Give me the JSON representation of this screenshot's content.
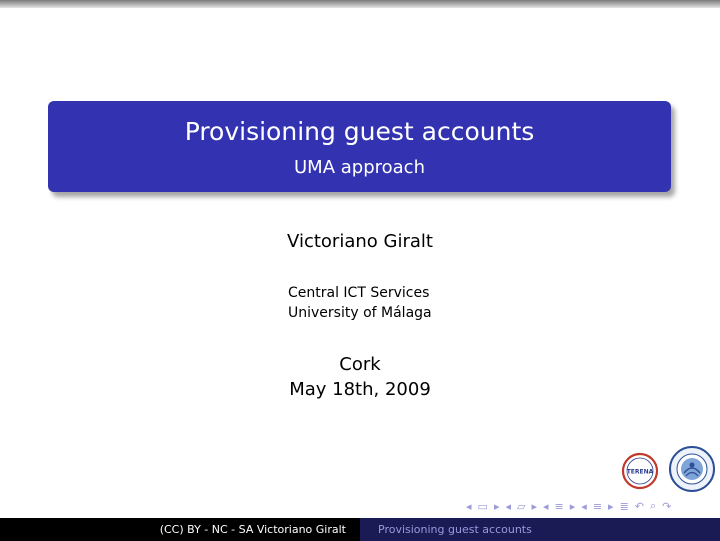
{
  "slide": {
    "title": "Provisioning guest accounts",
    "subtitle": "UMA approach",
    "author": "Victoriano Giralt",
    "institute_line1": "Central ICT Services",
    "institute_line2": "University of Málaga",
    "place": "Cork",
    "date": "May 18th, 2009"
  },
  "logos": {
    "left_text": "TERENA"
  },
  "footer": {
    "left": "(CC) BY - NC - SA Victoriano Giralt",
    "right": "Provisioning guest accounts"
  },
  "colors": {
    "title_box": "#3333b2",
    "footer_left_bg": "#000000",
    "footer_right_bg": "#1a1a55",
    "nav_icons": "#9b9bd8"
  }
}
